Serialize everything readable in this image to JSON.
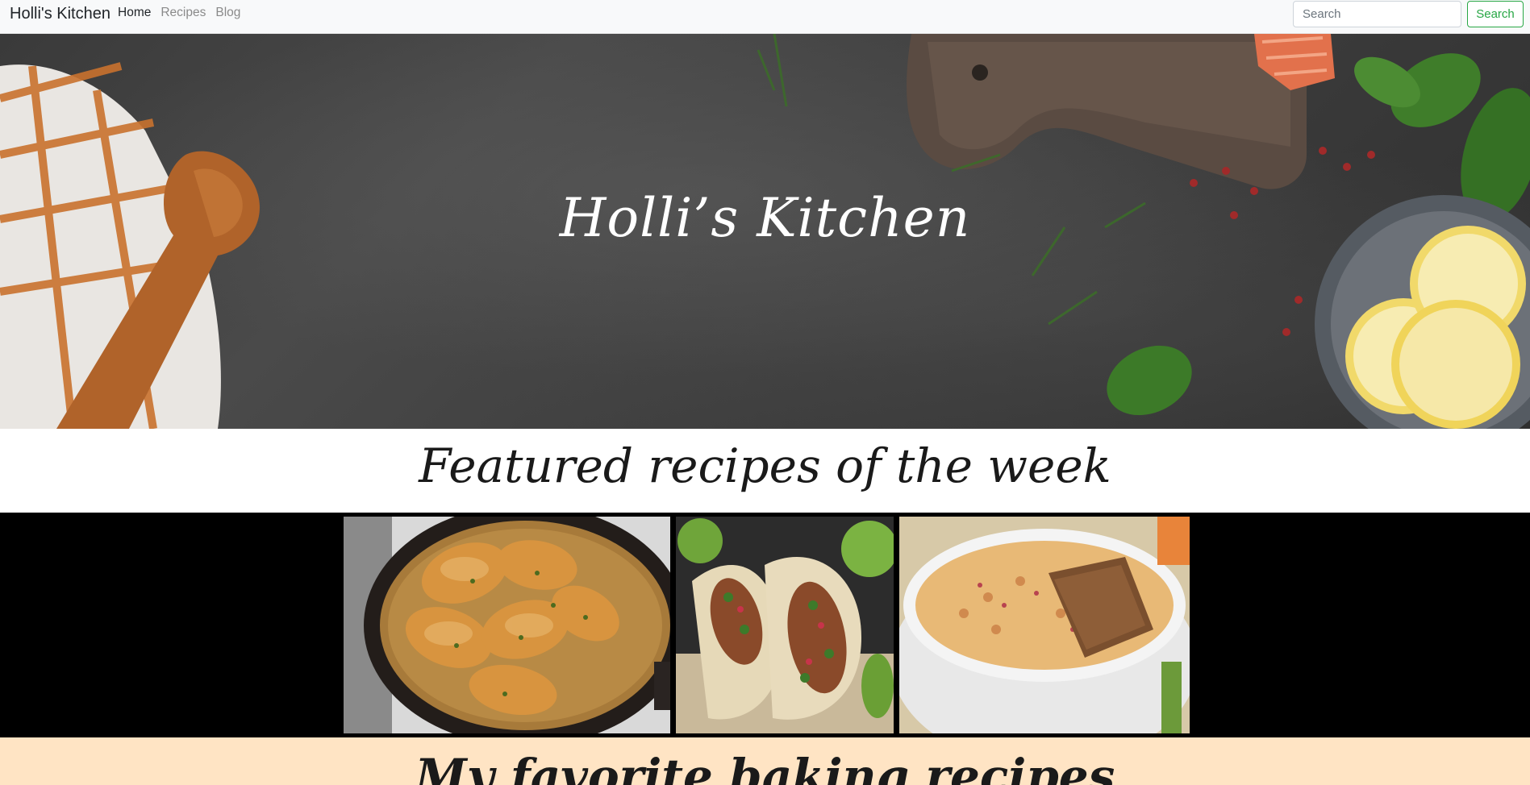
{
  "navbar": {
    "brand": "Holli's Kitchen",
    "links": [
      {
        "label": "Home",
        "active": true
      },
      {
        "label": "Recipes",
        "active": false
      },
      {
        "label": "Blog",
        "active": false
      }
    ],
    "search_placeholder": "Search",
    "search_button": "Search",
    "accent_color": "#28a745"
  },
  "hero": {
    "title": "Holli’s Kitchen"
  },
  "featured": {
    "title": "Featured recipes of the week",
    "photos": [
      {
        "icon": "chicken-piccata-photo"
      },
      {
        "icon": "street-tacos-photo"
      },
      {
        "icon": "pimento-cheese-dip-photo"
      }
    ]
  },
  "bottom": {
    "title": "My favorite baking recipes",
    "background": "#ffe4c4"
  }
}
